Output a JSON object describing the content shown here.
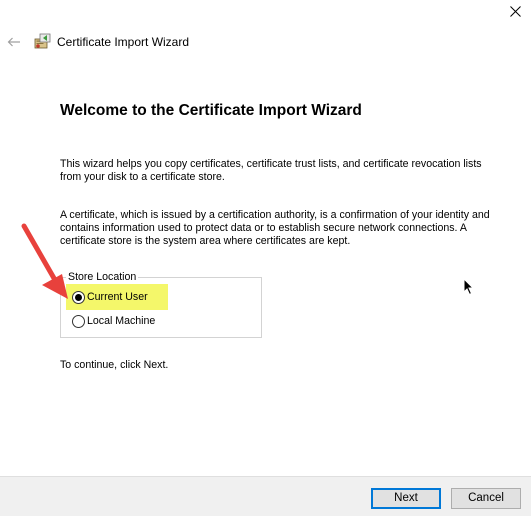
{
  "window": {
    "close_icon": "close-icon"
  },
  "header": {
    "back_icon": "back-arrow-icon",
    "wizard_icon": "certificate-wizard-icon",
    "title": "Certificate Import Wizard"
  },
  "content": {
    "heading": "Welcome to the Certificate Import Wizard",
    "intro": "This wizard helps you copy certificates, certificate trust lists, and certificate revocation lists from your disk to a certificate store.",
    "description": "A certificate, which is issued by a certification authority, is a confirmation of your identity and contains information used to protect data or to establish secure network connections. A certificate store is the system area where certificates are kept.",
    "store_location": {
      "legend": "Store Location",
      "options": [
        {
          "label": "Current User",
          "selected": true
        },
        {
          "label": "Local Machine",
          "selected": false
        }
      ]
    },
    "continue_text": "To continue, click Next."
  },
  "annotations": {
    "arrow_color": "#e8413c",
    "highlight_color": "#f4f76a"
  },
  "footer": {
    "next_label": "Next",
    "cancel_label": "Cancel"
  },
  "colors": {
    "accent": "#0078d7",
    "footer_bg": "#f0f0f0"
  }
}
